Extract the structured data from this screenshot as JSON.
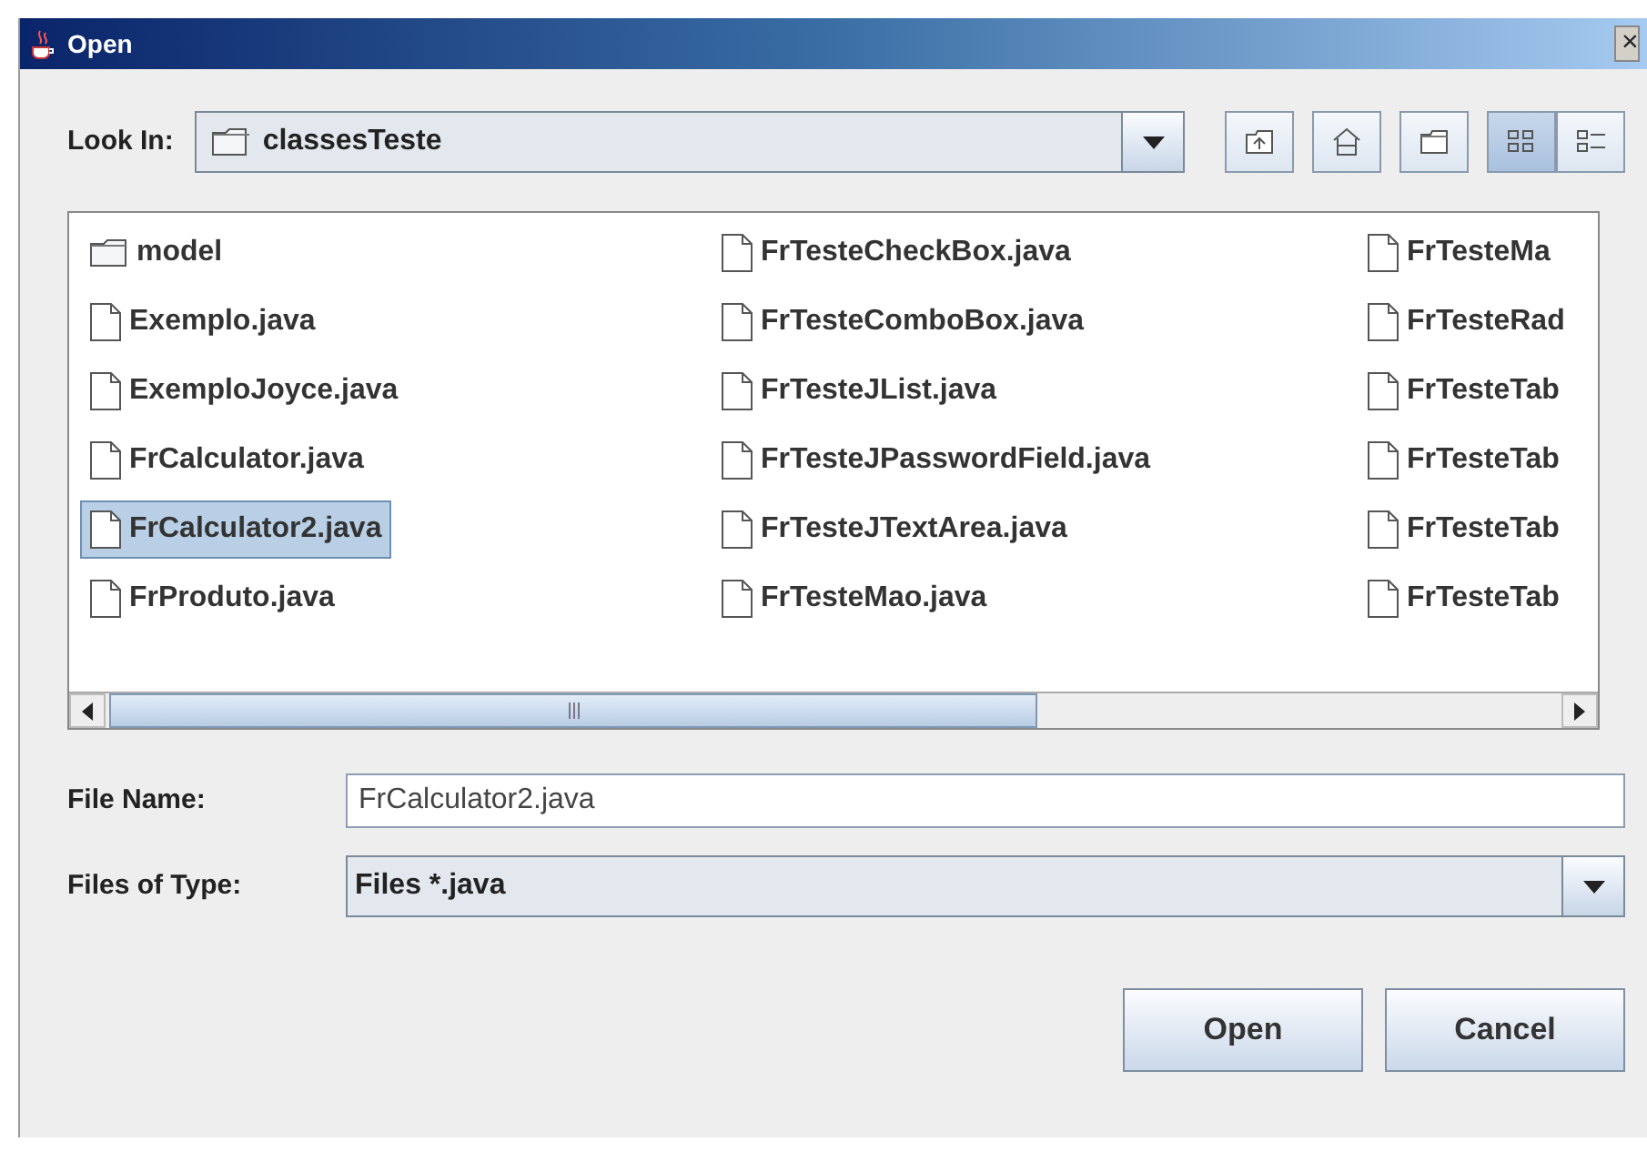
{
  "window": {
    "title": "Open",
    "close": "×"
  },
  "look_in": {
    "label": "Look In:",
    "value": "classesTeste"
  },
  "toolbar": [
    {
      "kind": "up",
      "selected": false
    },
    {
      "kind": "home",
      "selected": false
    },
    {
      "kind": "newfolder",
      "selected": false
    },
    {
      "kind": "list",
      "selected": true
    },
    {
      "kind": "details",
      "selected": false
    }
  ],
  "files": [
    [
      {
        "name": "model",
        "kind": "folder",
        "selected": false
      },
      {
        "name": "Exemplo.java",
        "kind": "file",
        "selected": false
      },
      {
        "name": "ExemploJoyce.java",
        "kind": "file",
        "selected": false
      },
      {
        "name": "FrCalculator.java",
        "kind": "file",
        "selected": false
      },
      {
        "name": "FrCalculator2.java",
        "kind": "file",
        "selected": true
      },
      {
        "name": "FrProduto.java",
        "kind": "file",
        "selected": false
      }
    ],
    [
      {
        "name": "FrTesteCheckBox.java",
        "kind": "file",
        "selected": false
      },
      {
        "name": "FrTesteComboBox.java",
        "kind": "file",
        "selected": false
      },
      {
        "name": "FrTesteJList.java",
        "kind": "file",
        "selected": false
      },
      {
        "name": "FrTesteJPasswordField.java",
        "kind": "file",
        "selected": false
      },
      {
        "name": "FrTesteJTextArea.java",
        "kind": "file",
        "selected": false
      },
      {
        "name": "FrTesteMao.java",
        "kind": "file",
        "selected": false
      }
    ],
    [
      {
        "name": "FrTesteMa",
        "kind": "file",
        "selected": false
      },
      {
        "name": "FrTesteRad",
        "kind": "file",
        "selected": false
      },
      {
        "name": "FrTesteTab",
        "kind": "file",
        "selected": false
      },
      {
        "name": "FrTesteTab",
        "kind": "file",
        "selected": false
      },
      {
        "name": "FrTesteTab",
        "kind": "file",
        "selected": false
      },
      {
        "name": "FrTesteTab",
        "kind": "file",
        "selected": false
      }
    ]
  ],
  "file_name": {
    "label": "File Name:",
    "value": "FrCalculator2.java"
  },
  "file_type": {
    "label": "Files of Type:",
    "value": "Files *.java"
  },
  "buttons": [
    "Open",
    "Cancel"
  ]
}
